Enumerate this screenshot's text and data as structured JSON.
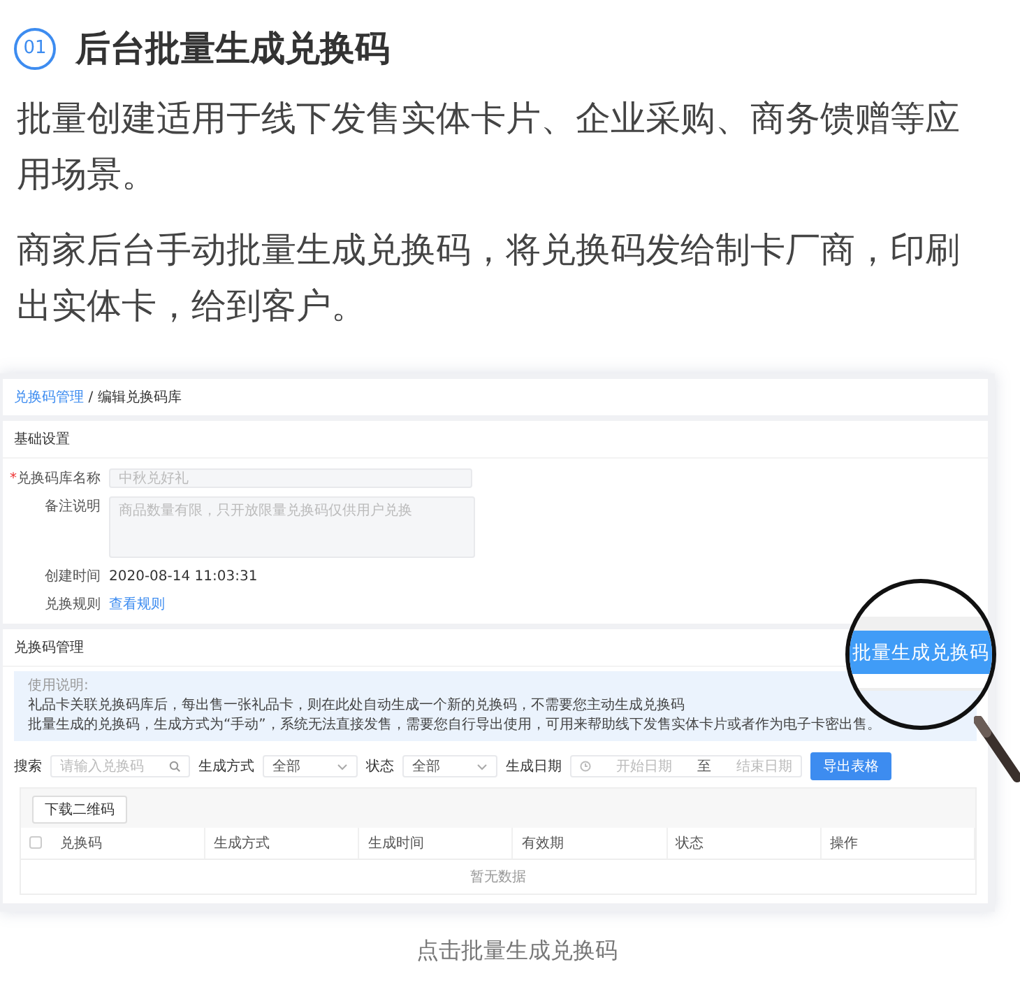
{
  "step": {
    "number": "01",
    "title": "后台批量生成兑换码"
  },
  "paragraphs": [
    "批量创建适用于线下发售实体卡片、企业采购、商务馈赠等应用场景。",
    "商家后台手动批量生成兑换码，将兑换码发给制卡厂商，印刷出实体卡，给到客户。"
  ],
  "screenshot": {
    "breadcrumb": {
      "link": "兑换码管理",
      "separator": "/",
      "current": "编辑兑换码库"
    },
    "basic_settings": {
      "title": "基础设置",
      "fields": [
        {
          "kind": "input",
          "label": "兑换码库名称",
          "required_mark": "*",
          "placeholder": "中秋兑好礼"
        },
        {
          "kind": "textarea",
          "label": "备注说明",
          "placeholder": "商品数量有限，只开放限量兑换码仅供用户兑换"
        },
        {
          "kind": "text",
          "label": "创建时间",
          "value": "2020-08-14 11:03:31"
        },
        {
          "kind": "link",
          "label": "兑换规则",
          "value": "查看规则"
        }
      ]
    },
    "code_management": {
      "title": "兑换码管理",
      "notice": {
        "title": "使用说明:",
        "lines": [
          "礼品卡关联兑换码库后，每出售一张礼品卡，则在此处自动生成一个新的兑换码，不需要您主动生成兑换码",
          "批量生成的兑换码，生成方式为“手动”，系统无法直接发售，需要您自行导出使用，可用来帮助线下发售实体卡片或者作为电子卡密出售。"
        ]
      },
      "filters": [
        {
          "kind": "search",
          "label": "搜索",
          "placeholder": "请输入兑换码"
        },
        {
          "kind": "select",
          "label": "生成方式",
          "value": "全部"
        },
        {
          "kind": "select",
          "label": "状态",
          "value": "全部"
        },
        {
          "kind": "daterange",
          "label": "生成日期",
          "start_placeholder": "开始日期",
          "separator": "至",
          "end_placeholder": "结束日期"
        }
      ],
      "export_button": "导出表格",
      "download_button": "下载二维码",
      "table": {
        "select_all_checked": false,
        "columns": [
          "兑换码",
          "生成方式",
          "生成时间",
          "有效期",
          "状态",
          "操作"
        ],
        "empty_text": "暂无数据"
      },
      "magnified_button": "批量生成兑换码"
    }
  },
  "caption": "点击批量生成兑换码"
}
